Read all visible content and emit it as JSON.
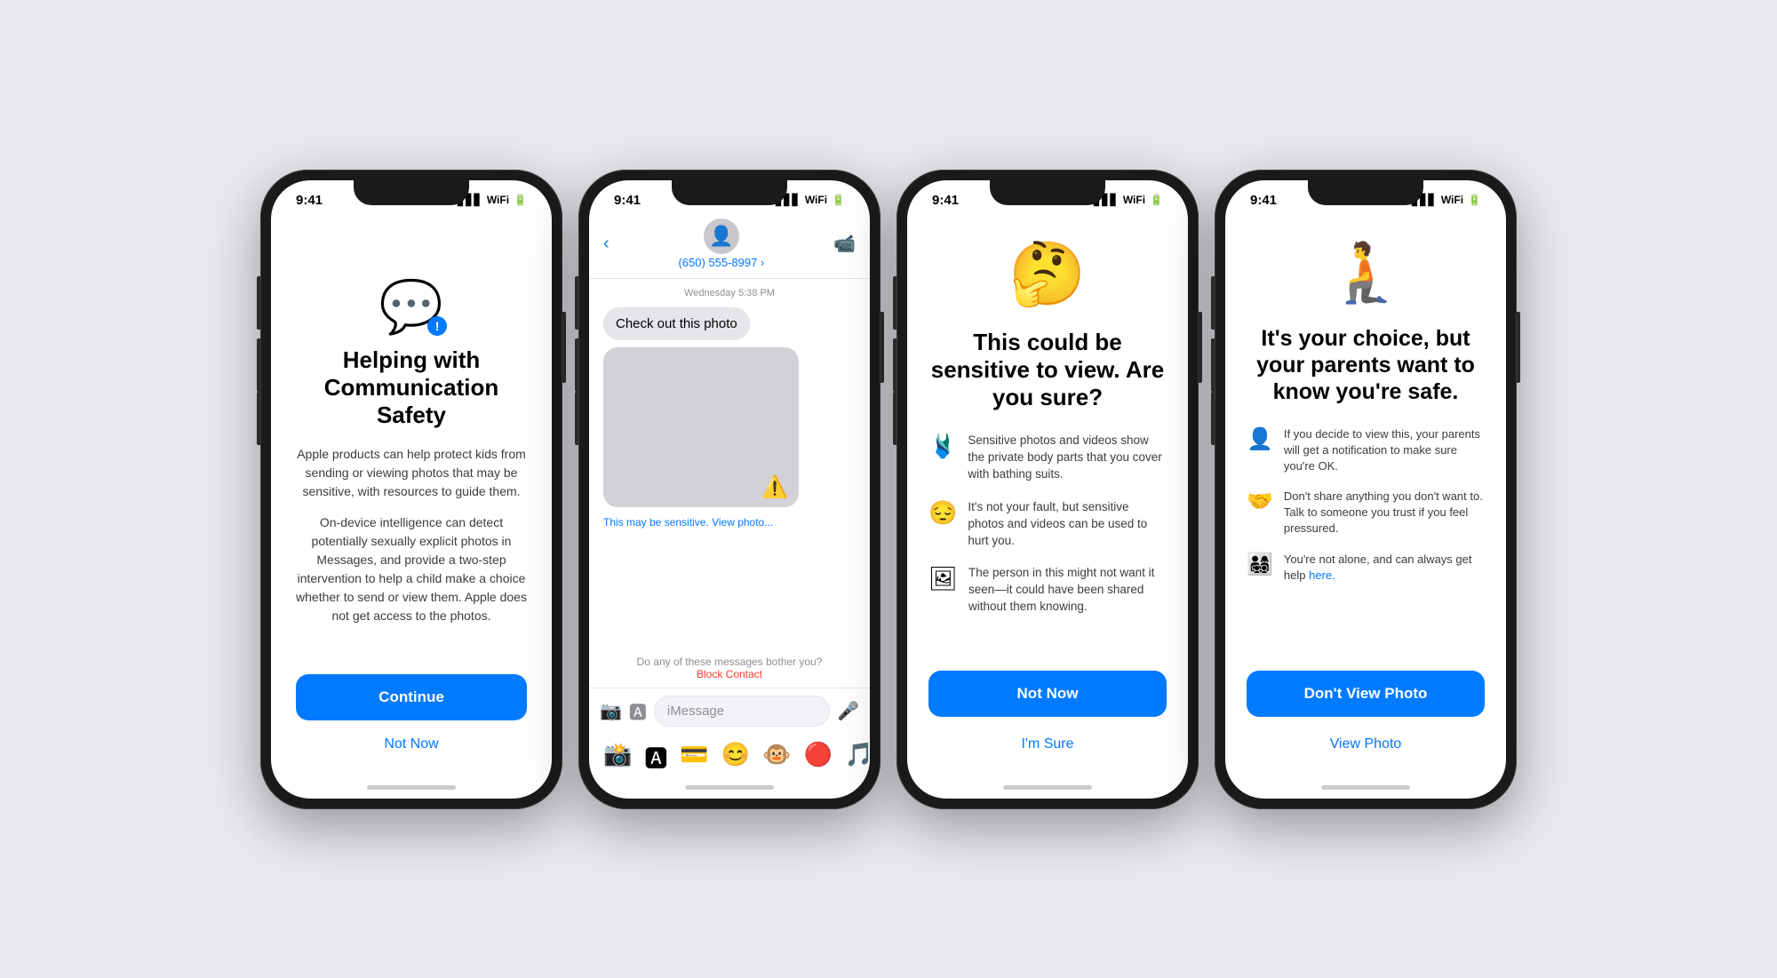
{
  "page": {
    "background": "#e8e8ed"
  },
  "phones": [
    {
      "id": "phone1",
      "status_time": "9:41",
      "title": "Helping with Communication Safety",
      "description1": "Apple products can help protect kids from sending or viewing photos that may be sensitive, with resources to guide them.",
      "description2": "On-device intelligence can detect potentially sexually explicit photos in Messages, and provide a two-step intervention to help a child make a choice whether to send or view them. Apple does not get access to the photos.",
      "primary_button": "Continue",
      "secondary_button": "Not Now",
      "icon": "💬",
      "icon_badge": "!"
    },
    {
      "id": "phone2",
      "status_time": "9:41",
      "back_label": "‹",
      "contact_number": "(650) 555-8997 ›",
      "video_icon": "📹",
      "date_label": "Wednesday 5:38 PM",
      "message_text": "Check out this photo",
      "sensitive_label": "This may be sensitive.",
      "view_link": "View photo...",
      "block_prompt": "Do any of these messages bother you?",
      "block_link": "Block Contact",
      "input_placeholder": "iMessage",
      "app_icons": [
        "📷",
        "🅰",
        "📩",
        "😊",
        "🐵",
        "🔴",
        "🎵"
      ]
    },
    {
      "id": "phone3",
      "status_time": "9:41",
      "emoji": "🤔",
      "title": "This could be sensitive to view. Are you sure?",
      "items": [
        {
          "icon": "🩱",
          "text": "Sensitive photos and videos show the private body parts that you cover with bathing suits."
        },
        {
          "icon": "😔",
          "text": "It's not your fault, but sensitive photos and videos can be used to hurt you."
        },
        {
          "icon": "🖼",
          "text": "The person in this might not want it seen—it could have been shared without them knowing."
        }
      ],
      "primary_button": "Not Now",
      "secondary_button": "I'm Sure"
    },
    {
      "id": "phone4",
      "status_time": "9:41",
      "emoji": "🧎",
      "title": "It's your choice, but your parents want to know you're safe.",
      "items": [
        {
          "icon": "👤",
          "text": "If you decide to view this, your parents will get a notification to make sure you're OK."
        },
        {
          "icon": "🤝",
          "text": "Don't share anything you don't want to. Talk to someone you trust if you feel pressured."
        },
        {
          "icon": "👨‍👩‍👧‍👦",
          "text": "You're not alone, and can always get help here."
        }
      ],
      "primary_button": "Don't View Photo",
      "secondary_button": "View Photo"
    }
  ]
}
